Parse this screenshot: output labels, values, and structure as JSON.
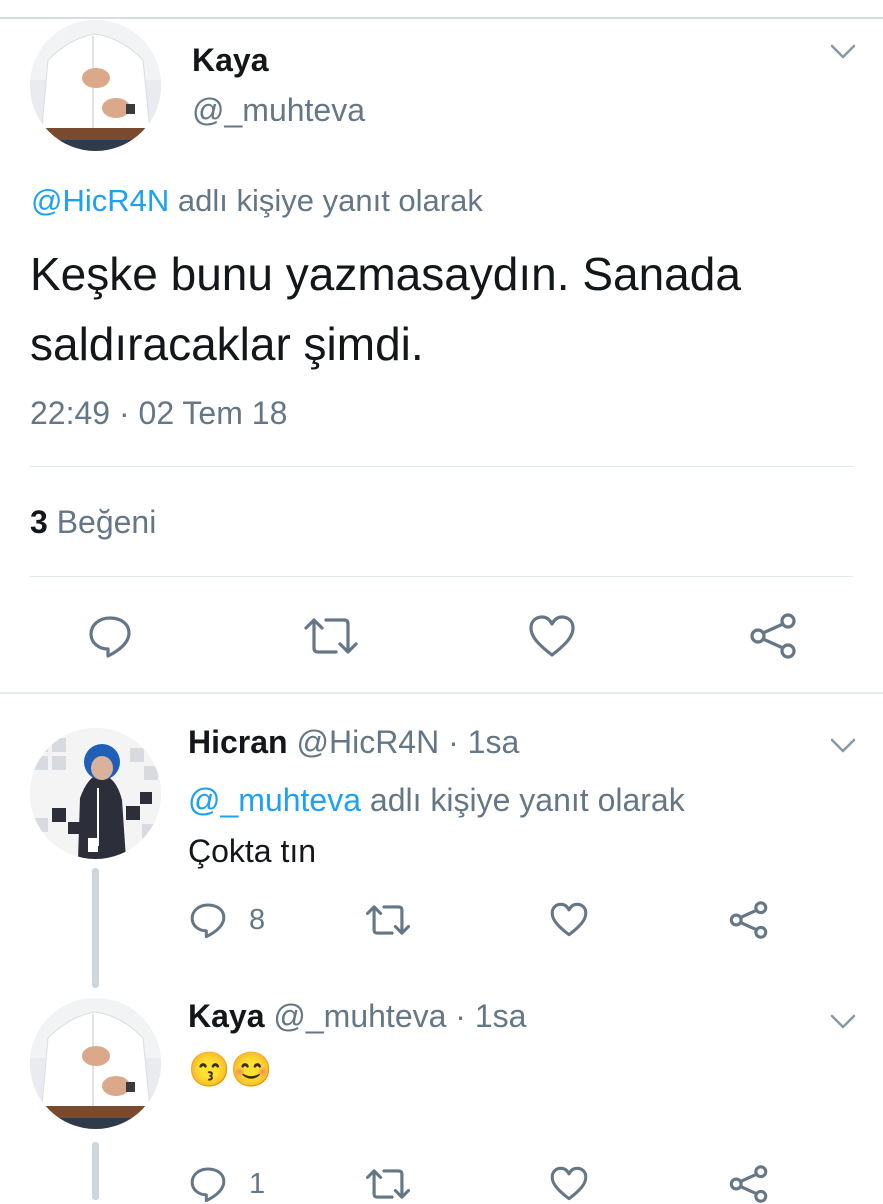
{
  "main_tweet": {
    "author_name": "Kaya",
    "author_handle": "@_muhteva",
    "reply_to_handle": "@HicR4N",
    "reply_to_suffix": "adlı kişiye yanıt olarak",
    "text_line1": "Keşke bunu yazmasaydın. Sanada",
    "text_line2": "saldıracaklar şimdi.",
    "timestamp": "22:49 · 02 Tem 18",
    "likes_count": "3",
    "likes_label": "Beğeni",
    "icons": [
      "reply-icon",
      "retweet-icon",
      "like-icon",
      "share-icon"
    ]
  },
  "replies": [
    {
      "author_name": "Hicran",
      "author_handle": "@HicR4N",
      "time": "· 1sa",
      "reply_to_handle": "@_muhteva",
      "reply_to_suffix": "adlı kişiye yanıt olarak",
      "text": "Çokta tın",
      "reply_count": "8"
    },
    {
      "author_name": "Kaya",
      "author_handle": "@_muhteva",
      "time": "· 1sa",
      "emojis": [
        "😙",
        "😊"
      ],
      "reply_count": "1"
    }
  ],
  "colors": {
    "link": "#1da1f2",
    "muted": "#657786",
    "icon": "#657786",
    "divider": "#e1e8ed"
  }
}
